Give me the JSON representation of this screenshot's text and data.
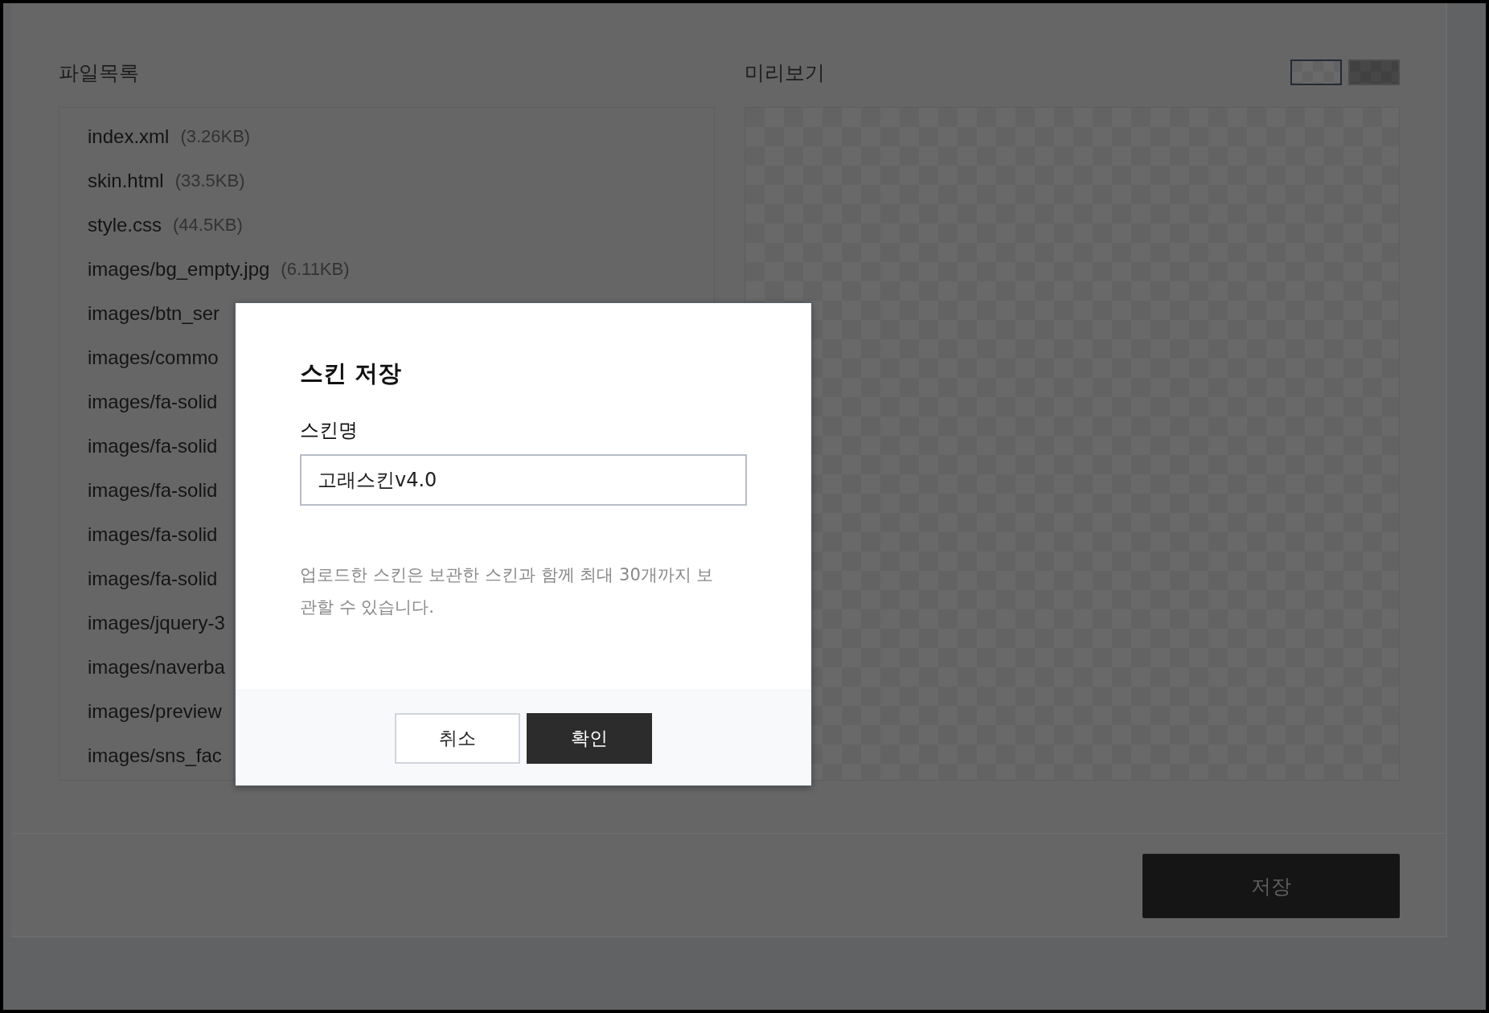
{
  "files": {
    "title": "파일목록",
    "items": [
      {
        "name": "index.xml",
        "size": "(3.26KB)"
      },
      {
        "name": "skin.html",
        "size": "(33.5KB)"
      },
      {
        "name": "style.css",
        "size": "(44.5KB)"
      },
      {
        "name": "images/bg_empty.jpg",
        "size": "(6.11KB)"
      },
      {
        "name": "images/btn_ser"
      },
      {
        "name": "images/commo"
      },
      {
        "name": "images/fa-solid"
      },
      {
        "name": "images/fa-solid"
      },
      {
        "name": "images/fa-solid"
      },
      {
        "name": "images/fa-solid"
      },
      {
        "name": "images/fa-solid"
      },
      {
        "name": "images/jquery-3"
      },
      {
        "name": "images/naverba"
      },
      {
        "name": "images/preview"
      },
      {
        "name": "images/sns_fac"
      }
    ]
  },
  "preview": {
    "title": "미리보기",
    "backgrounds": [
      {
        "kind": "light",
        "selected": true
      },
      {
        "kind": "dark",
        "selected": false
      }
    ]
  },
  "save_button": "저장",
  "dialog": {
    "title": "스킨 저장",
    "field_label": "스킨명",
    "value": "고래스킨v4.0",
    "note": "업로드한 스킨은 보관한 스킨과 함께 최대 30개까지 보관할 수 있습니다.",
    "buttons": [
      {
        "label": "취소",
        "kind": "secondary"
      },
      {
        "label": "확인",
        "kind": "primary"
      }
    ]
  }
}
